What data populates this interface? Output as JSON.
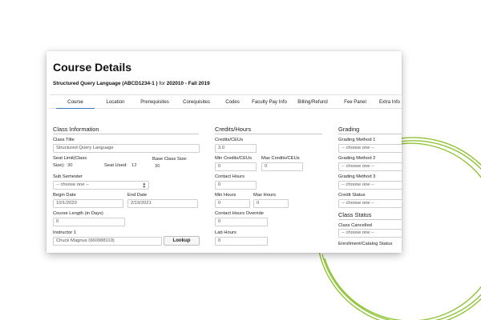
{
  "page": {
    "title": "Course Details",
    "subtitle": {
      "course": "Structured Query Language (ABCD1234-1 )",
      "for": "for",
      "term": "202010 - Fall 2019"
    }
  },
  "tabs": [
    {
      "label": "Course",
      "active": true
    },
    {
      "label": "Location"
    },
    {
      "label": "Prerequisites"
    },
    {
      "label": "Corequisites"
    },
    {
      "label": "Codes"
    },
    {
      "label": "Faculty Pay Info"
    },
    {
      "label": "Billing/Refund"
    },
    {
      "label": "Fee Panel"
    },
    {
      "label": "Extra Info"
    }
  ],
  "class_info": {
    "heading": "Class Information",
    "class_title_label": "Class Title",
    "class_title_value": "Structured Query Language",
    "seat_limit_label_1": "Seat Limit(Class",
    "seat_limit_label_2": "Size):",
    "seat_limit_value": "30",
    "seat_used_label": "Seat Used:",
    "seat_used_value": "12",
    "base_class_size_label": "Base Class Size:",
    "base_class_size_value": "30",
    "sub_semester_label": "Sub Semester",
    "sub_semester_value": "-- choose one --",
    "begin_date_label": "Begin Date",
    "begin_date_value": "10/1/2020",
    "end_date_label": "End Date",
    "end_date_value": "2/19/2021",
    "course_length_label": "Course Length (in Days)",
    "course_length_value": "0",
    "instructor_label": "Instructor 1",
    "instructor_value": "Chuck Magnus (660088110)",
    "lookup_label": "Lookup"
  },
  "credits": {
    "heading": "Credits/Hours",
    "credits_ceus_label": "Credits/CEUs",
    "credits_ceus_value": "3.0",
    "min_credits_label": "Min Credits/CEUs",
    "min_credits_value": "0",
    "max_credits_label": "Max Credits/CEUs",
    "max_credits_value": "0",
    "contact_hours_label": "Contact Hours",
    "contact_hours_value": "0",
    "min_hours_label": "Min Hours",
    "min_hours_value": "0",
    "max_hours_label": "Max Hours",
    "max_hours_value": "0",
    "contact_override_label": "Contact Hours Override",
    "contact_override_value": "0",
    "lab_hours_label": "Lab Hours",
    "lab_hours_value": "0"
  },
  "grading": {
    "heading": "Grading",
    "method1_label": "Grading Method 1",
    "method1_value": "-- choose one --",
    "method2_label": "Grading Method 2",
    "method2_value": "-- choose one --",
    "method3_label": "Grading Method 3",
    "method3_value": "-- choose one --",
    "credit_status_label": "Credit Status",
    "credit_status_value": "-- choose one --"
  },
  "class_status": {
    "heading": "Class Status",
    "cancelled_label": "Class Cancelled",
    "cancelled_value": "-- choose one --",
    "enrollment_label": "Enrollment/Catalog Status"
  },
  "colors": {
    "accent": "#3a78c2",
    "decoration": "#8fc435"
  }
}
